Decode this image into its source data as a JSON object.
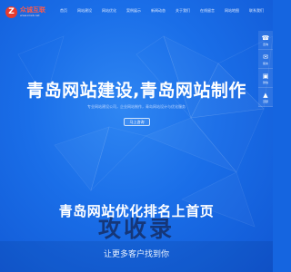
{
  "logo": {
    "mark": "Z",
    "name": "众诚互联",
    "tagline": "www.zcwb.net"
  },
  "nav": {
    "items": [
      "首页",
      "网站建设",
      "网站优化",
      "案例展示",
      "新闻动态",
      "关于我们",
      "在线留言",
      "网站地图",
      "联系我们"
    ]
  },
  "sidebar": {
    "items": [
      {
        "icon": "☎",
        "label": "咨询"
      },
      {
        "icon": "✉",
        "label": "留言"
      },
      {
        "icon": "▣",
        "label": "微信"
      },
      {
        "icon": "▲",
        "label": "顶部"
      }
    ]
  },
  "hero": {
    "title": "青岛网站建设,青岛网站制作",
    "subtitle": "专业网站建设公司，企业网站制作，青岛网站设计与优化服务",
    "cta": "马上咨询"
  },
  "section2": {
    "headline": "青岛网站优化排名上首页",
    "bottom_text": "让更多客户找到你"
  },
  "watermark": {
    "text": "攻收录"
  },
  "colors": {
    "bg": "#1a6ee8",
    "logo_red": "#e63b2e",
    "text": "#ffffff"
  }
}
